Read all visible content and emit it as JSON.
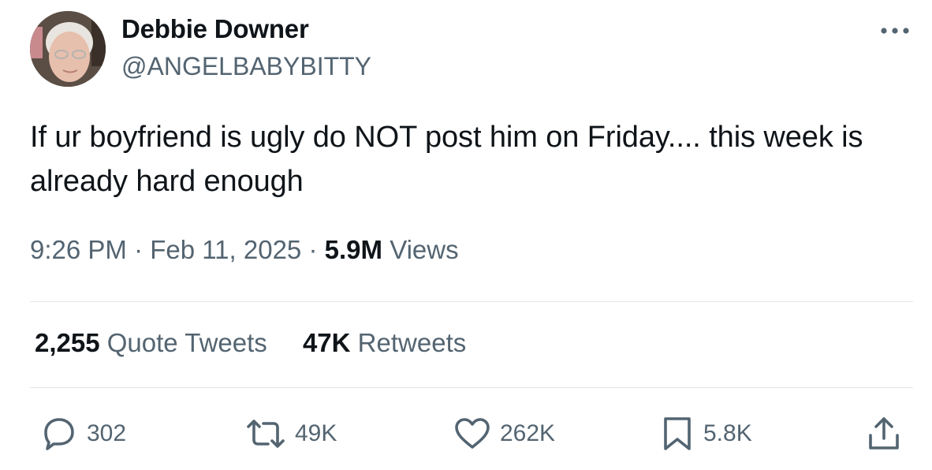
{
  "author": {
    "display_name": "Debbie Downer",
    "handle": "@ANGELBABYBITTY"
  },
  "tweet": {
    "text": "If ur boyfriend is ugly do NOT post him on Friday.... this week is already hard enough",
    "time": "9:26 PM",
    "separator": "·",
    "date": "Feb 11, 2025",
    "views_count": "5.9M",
    "views_label": "Views"
  },
  "stats": {
    "quote_tweets_count": "2,255",
    "quote_tweets_label": "Quote Tweets",
    "retweets_count": "47K",
    "retweets_label": "Retweets"
  },
  "actions": {
    "replies": "302",
    "retweets": "49K",
    "likes": "262K",
    "bookmarks": "5.8K"
  },
  "icons": {
    "more": "more-horizontal-icon",
    "reply": "speech-bubble-icon",
    "retweet": "retweet-arrows-icon",
    "like": "heart-icon",
    "bookmark": "bookmark-icon",
    "share": "share-upload-icon"
  },
  "colors": {
    "text_primary": "#0f1419",
    "text_secondary": "#536471",
    "divider": "#e3e7ea",
    "background": "#ffffff"
  }
}
